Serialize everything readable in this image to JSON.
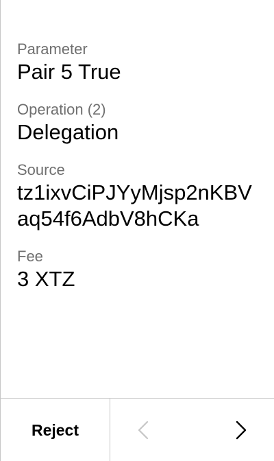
{
  "fields": [
    {
      "label": "Parameter",
      "value": "Pair 5 True"
    },
    {
      "label": "Operation (2)",
      "value": "Delegation"
    },
    {
      "label": "Source",
      "value": "tz1ixvCiPJYyMjsp2nKBVaq54f6AdbV8hCKa"
    },
    {
      "label": "Fee",
      "value": "3 XTZ"
    }
  ],
  "footer": {
    "reject_label": "Reject",
    "prev_icon": "chevron-left-icon",
    "next_icon": "chevron-right-icon",
    "prev_color": "#c6c6c6",
    "next_color": "#000000"
  }
}
